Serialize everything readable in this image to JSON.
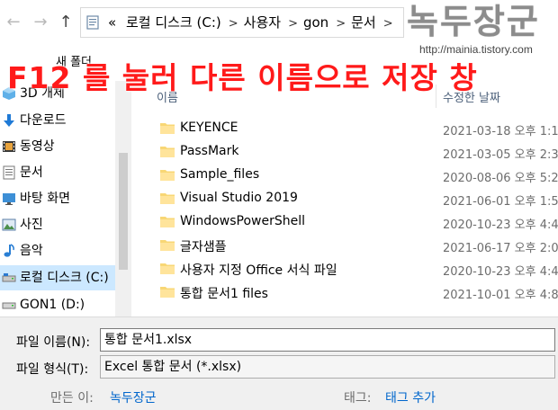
{
  "nav": {
    "back_glyph": "←",
    "forward_glyph": "→",
    "up_glyph": "↑",
    "chevron_glyph": "«",
    "breadcrumbs": [
      "로컬 디스크 (C:)",
      "사용자",
      "gon",
      "문서"
    ]
  },
  "watermark": {
    "title": "녹두장군",
    "url": "http://mainia.tistory.com"
  },
  "banner": "F12 를 눌러 다른 이름으로 저장 창",
  "toolbar": {
    "new_folder": "새 폴더"
  },
  "sidebar": {
    "items": [
      {
        "label": "3D 개체",
        "icon": "3d-objects-icon"
      },
      {
        "label": "다운로드",
        "icon": "download-icon"
      },
      {
        "label": "동영상",
        "icon": "video-icon"
      },
      {
        "label": "문서",
        "icon": "document-icon"
      },
      {
        "label": "바탕 화면",
        "icon": "desktop-icon"
      },
      {
        "label": "사진",
        "icon": "pictures-icon"
      },
      {
        "label": "음악",
        "icon": "music-icon"
      },
      {
        "label": "로컬 디스크 (C:)",
        "icon": "drive-icon",
        "selected": true
      },
      {
        "label": "GON1 (D:)",
        "icon": "drive-icon"
      }
    ]
  },
  "filelist": {
    "col_name": "이름",
    "col_date": "수정한 날짜",
    "rows": [
      {
        "name": "KEYENCE",
        "date": "2021-03-18 오후 1:1"
      },
      {
        "name": "PassMark",
        "date": "2021-03-05 오후 2:3"
      },
      {
        "name": "Sample_files",
        "date": "2020-08-06 오후 5:2"
      },
      {
        "name": "Visual Studio 2019",
        "date": "2021-06-01 오후 1:5"
      },
      {
        "name": "WindowsPowerShell",
        "date": "2020-10-23 오후 4:4"
      },
      {
        "name": "글자샘플",
        "date": "2021-06-17 오후 2:0"
      },
      {
        "name": "사용자 지정 Office 서식 파일",
        "date": "2020-10-23 오후 4:4"
      },
      {
        "name": "통합 문서1 files",
        "date": "2021-10-01 오후 4:8"
      }
    ]
  },
  "form": {
    "filename_label": "파일 이름(N):",
    "filename_value": "통합 문서1.xlsx",
    "filetype_label": "파일 형식(T):",
    "filetype_value": "Excel 통합 문서 (*.xlsx)",
    "author_label": "만든 이:",
    "author_value": "녹두장군",
    "tags_label": "태그:",
    "tags_value": "태그 추가"
  },
  "colors": {
    "folder": "#f8d775",
    "selected": "#cce8ff",
    "banner": "#ff1a1a",
    "link": "#0066cc"
  }
}
